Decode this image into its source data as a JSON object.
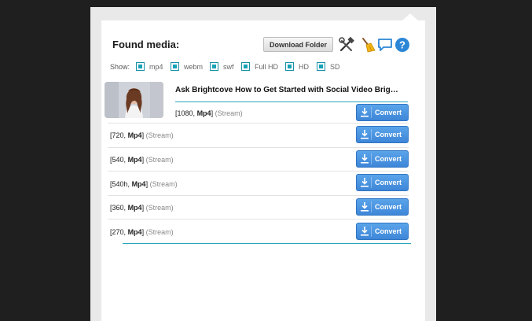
{
  "header": {
    "title": "Found media:",
    "download_folder_label": "Download Folder",
    "icons": [
      "tools-icon",
      "broom-icon",
      "chat-bubble-icon",
      "help-icon"
    ]
  },
  "filters": {
    "show_label": "Show:",
    "items": [
      {
        "label": "mp4",
        "checked": true
      },
      {
        "label": "webm",
        "checked": true
      },
      {
        "label": "swf",
        "checked": true
      },
      {
        "label": "Full HD",
        "checked": true
      },
      {
        "label": "HD",
        "checked": true
      },
      {
        "label": "SD",
        "checked": true
      }
    ]
  },
  "video": {
    "title": "Ask Brightcove How to Get Started with Social Video Brig…",
    "convert_label": "Convert",
    "formats": [
      {
        "res": "1080",
        "container": "Mp4",
        "type": "(Stream)"
      },
      {
        "res": "720",
        "container": "Mp4",
        "type": "(Stream)"
      },
      {
        "res": "540",
        "container": "Mp4",
        "type": "(Stream)"
      },
      {
        "res": "540h",
        "container": "Mp4",
        "type": "(Stream)"
      },
      {
        "res": "360",
        "container": "Mp4",
        "type": "(Stream)"
      },
      {
        "res": "270",
        "container": "Mp4",
        "type": "(Stream)"
      }
    ]
  },
  "colors": {
    "accent": "#29a8bd",
    "button_blue": "#4a94e0"
  }
}
